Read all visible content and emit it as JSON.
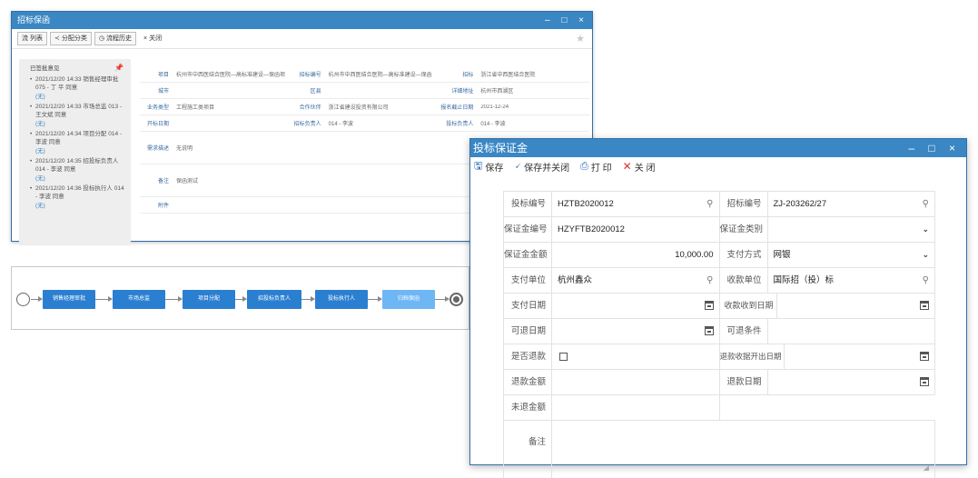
{
  "bg_window": {
    "title": "招标保函",
    "ctrls": "– □ ×",
    "toolbar": [
      {
        "icon": "流",
        "label": "列表"
      },
      {
        "icon": "≺",
        "label": "分配分类"
      },
      {
        "icon": "◷",
        "label": "流程历史"
      },
      {
        "icon": "×",
        "label": "关闭"
      }
    ],
    "star": "★",
    "side": {
      "head": "已签批意见",
      "pin": "📌",
      "items": [
        {
          "text": "2021/12/20 14:33 销售经理审批 075 - 丁 平 同意",
          "note": "(无)"
        },
        {
          "text": "2021/12/20 14:33 市场总监 013 - 王文斌 同意",
          "note": "(无)"
        },
        {
          "text": "2021/12/20 14:34 项目分配 014 - 李波 同意",
          "note": "(无)"
        },
        {
          "text": "2021/12/20 14:35 招投标负责人 014 - 李波 同意",
          "note": "(无)"
        },
        {
          "text": "2021/12/20 14:36 投标执行人 014 - 李波 同意",
          "note": "(无)"
        }
      ]
    },
    "form": [
      [
        {
          "label": "项目",
          "value": "杭州市中西医结合医院—高标准建设—保函项目"
        },
        {
          "label": "招标编号",
          "value": "杭州市中西医结合医院—高标准建设—保函"
        },
        {
          "label": "招标",
          "value": "浙江省中西医结合医院"
        }
      ],
      [
        {
          "label": "城市",
          "value": ""
        },
        {
          "label": "区县",
          "value": ""
        },
        {
          "label": "详细地址",
          "value": "杭州市西湖区"
        }
      ],
      [
        {
          "label": "业务类型",
          "value": "工程施工类项目"
        },
        {
          "label": "合作伙伴",
          "value": "浙江省建设投资有限公司"
        },
        {
          "label": "报名截止日期",
          "value": "2021-12-24"
        }
      ],
      [
        {
          "label": "开标日期",
          "value": ""
        },
        {
          "label": "招标负责人",
          "value": "014 - 李波"
        },
        {
          "label": "投标负责人",
          "value": "014 - 李波"
        }
      ],
      [
        {
          "label": "需求描述",
          "value": "无说明"
        }
      ],
      [
        {
          "label": "备注",
          "value": "保函测试"
        }
      ],
      [
        {
          "label": "附件",
          "value": ""
        }
      ]
    ]
  },
  "flow": {
    "nodes": [
      "销售经理审批",
      "市场总监",
      "项目分配",
      "招投标负责人",
      "投标执行人",
      "归档保函"
    ]
  },
  "fg_window": {
    "title": "投标保证金",
    "ctrls": "– □ ×",
    "toolbar": {
      "save": "保存",
      "save_close": "保存并关闭",
      "print": "打 印",
      "close": "关 闭"
    },
    "rows": [
      {
        "l1": "投标编号",
        "v1": "HZTB2020012",
        "l2": "招标编号",
        "v2": "ZJ-203262/27"
      },
      {
        "l1": "保证金编号",
        "v1": "HZYFTB2020012",
        "l2": "保证金类别",
        "v2": ""
      },
      {
        "l1": "保证金金额",
        "v1": "10,000.00",
        "l2": "支付方式",
        "v2": "网银"
      },
      {
        "l1": "支付单位",
        "v1": "杭州鑫众",
        "l2": "收款单位",
        "v2": "国际招（投）标"
      },
      {
        "l1": "支付日期",
        "v1": "",
        "l2": "收款收到日期",
        "v2": ""
      },
      {
        "l1": "可退日期",
        "v1": "",
        "l2": "可退条件",
        "v2": ""
      },
      {
        "l1": "是否退款",
        "v1": "",
        "l2": "退款收据开出日期",
        "v2": ""
      },
      {
        "l1": "退款金额",
        "v1": "",
        "l2": "退款日期",
        "v2": ""
      },
      {
        "l1": "未退金额",
        "v1": ""
      },
      {
        "l1": "备注",
        "v1": ""
      }
    ]
  }
}
